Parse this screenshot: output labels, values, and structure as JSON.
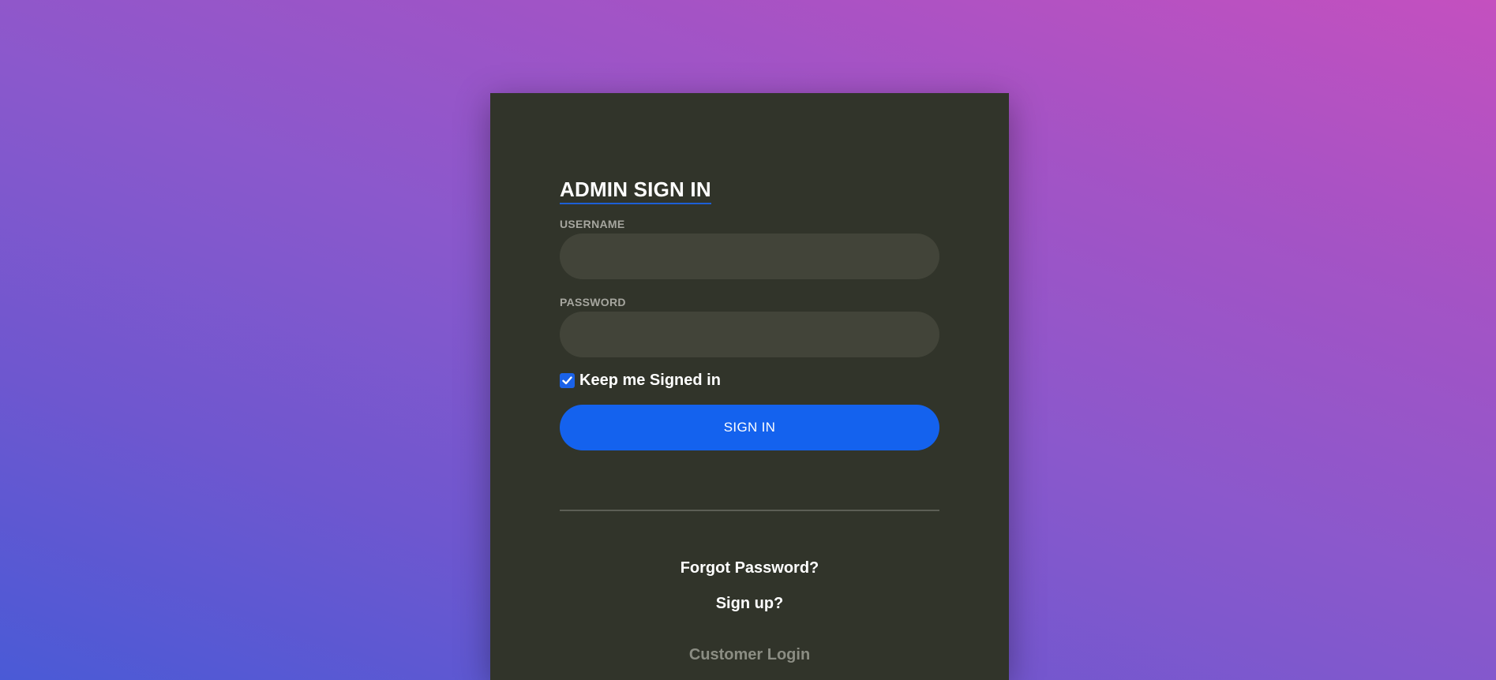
{
  "login": {
    "title": "ADMIN SIGN IN",
    "username_label": "USERNAME",
    "username_value": "",
    "password_label": "PASSWORD",
    "password_value": "",
    "keep_signed_in_label": "Keep me Signed in",
    "keep_signed_in_checked": true,
    "signin_label": "SIGN IN",
    "forgot_password_label": "Forgot Password?",
    "signup_label": "Sign up?",
    "customer_login_label": "Customer Login"
  },
  "colors": {
    "accent": "#1462ee",
    "card_background": "#31342a",
    "input_background": "#424439"
  },
  "icons": {
    "checkbox": "check-icon"
  }
}
